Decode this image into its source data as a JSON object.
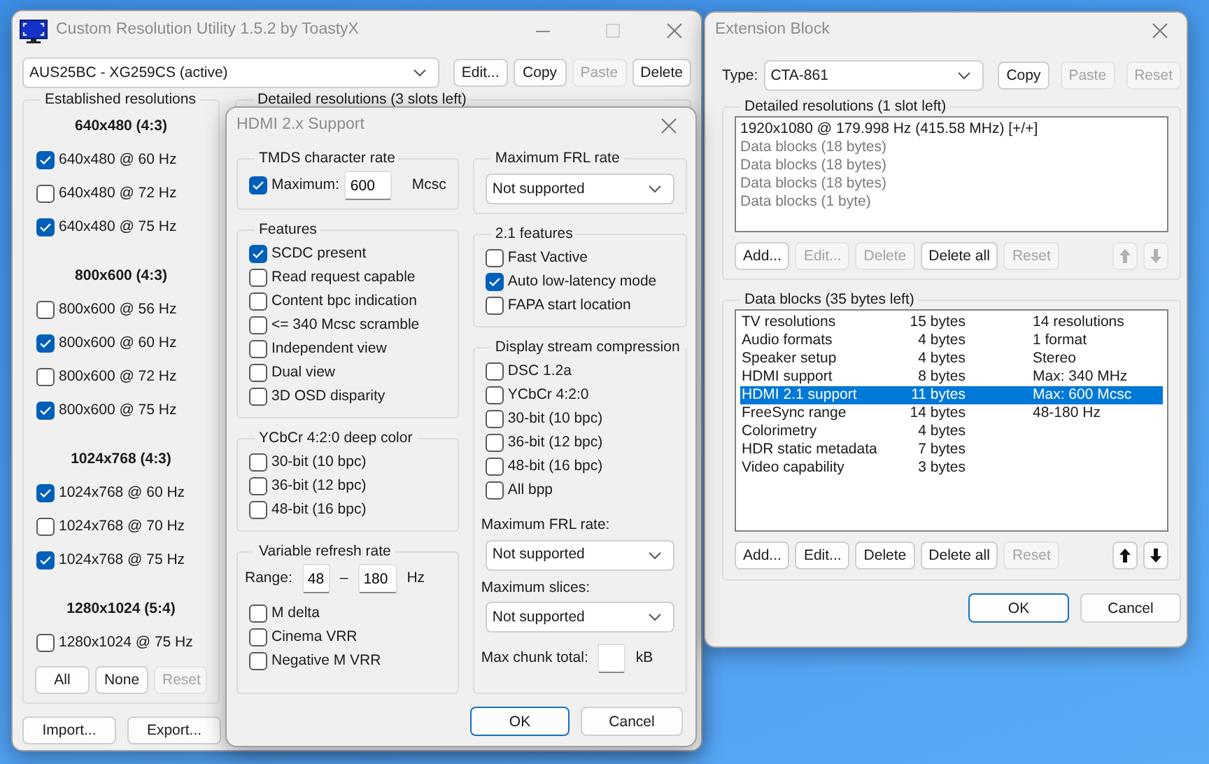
{
  "main_window": {
    "title": "Custom Resolution Utility 1.5.2 by ToastyX",
    "device": "AUS25BC - XG259CS (active)",
    "toolbar": [
      {
        "label": "Edit...",
        "disabled": false
      },
      {
        "label": "Copy",
        "disabled": false
      },
      {
        "label": "Paste",
        "disabled": true
      },
      {
        "label": "Delete",
        "disabled": false
      }
    ],
    "established": {
      "title": "Established resolutions",
      "groups": [
        {
          "heading": "640x480 (4:3)",
          "items": [
            {
              "label": "640x480 @ 60 Hz",
              "checked": true
            },
            {
              "label": "640x480 @ 72 Hz",
              "checked": false
            },
            {
              "label": "640x480 @ 75 Hz",
              "checked": true
            }
          ]
        },
        {
          "heading": "800x600 (4:3)",
          "items": [
            {
              "label": "800x600 @ 56 Hz",
              "checked": false
            },
            {
              "label": "800x600 @ 60 Hz",
              "checked": true
            },
            {
              "label": "800x600 @ 72 Hz",
              "checked": false
            },
            {
              "label": "800x600 @ 75 Hz",
              "checked": true
            }
          ]
        },
        {
          "heading": "1024x768 (4:3)",
          "items": [
            {
              "label": "1024x768 @ 60 Hz",
              "checked": true
            },
            {
              "label": "1024x768 @ 70 Hz",
              "checked": false
            },
            {
              "label": "1024x768 @ 75 Hz",
              "checked": true
            }
          ]
        },
        {
          "heading": "1280x1024 (5:4)",
          "items": [
            {
              "label": "1280x1024 @ 75 Hz",
              "checked": false
            }
          ]
        }
      ],
      "buttons": [
        {
          "label": "All",
          "disabled": false
        },
        {
          "label": "None",
          "disabled": false
        },
        {
          "label": "Reset",
          "disabled": true
        }
      ]
    },
    "detailed_title": "Detailed resolutions (3 slots left)",
    "footer_buttons": [
      {
        "label": "Import..."
      },
      {
        "label": "Export..."
      }
    ]
  },
  "hdmi_dialog": {
    "title": "HDMI 2.x Support",
    "left": [
      {
        "kind": "tmds",
        "title": "TMDS character rate",
        "checkbox": {
          "label": "Maximum:",
          "checked": true
        },
        "value": "600",
        "unit": "Mcsc"
      },
      {
        "kind": "checks",
        "title": "Features",
        "items": [
          {
            "label": "SCDC present",
            "checked": true
          },
          {
            "label": "Read request capable",
            "checked": false
          },
          {
            "label": "Content bpc indication",
            "checked": false
          },
          {
            "label": "<= 340 Mcsc scramble",
            "checked": false
          },
          {
            "label": "Independent view",
            "checked": false
          },
          {
            "label": "Dual view",
            "checked": false
          },
          {
            "label": "3D OSD disparity",
            "checked": false
          }
        ]
      },
      {
        "kind": "checks",
        "title": "YCbCr 4:2:0 deep color",
        "items": [
          {
            "label": "30-bit (10 bpc)",
            "checked": false
          },
          {
            "label": "36-bit (12 bpc)",
            "checked": false
          },
          {
            "label": "48-bit (16 bpc)",
            "checked": false
          }
        ]
      },
      {
        "kind": "vrr",
        "title": "Variable refresh rate",
        "label": "Range:",
        "min": "48",
        "separator": "–",
        "max": "180",
        "unit": "Hz",
        "items": [
          {
            "label": "M delta",
            "checked": false
          },
          {
            "label": "Cinema VRR",
            "checked": false
          },
          {
            "label": "Negative M VRR",
            "checked": false
          }
        ]
      }
    ],
    "right": [
      {
        "kind": "select",
        "title": "Maximum FRL rate",
        "value": "Not supported"
      },
      {
        "kind": "checks",
        "title": "2.1 features",
        "items": [
          {
            "label": "Fast Vactive",
            "checked": false
          },
          {
            "label": "Auto low-latency mode",
            "checked": true
          },
          {
            "label": "FAPA start location",
            "checked": false
          }
        ]
      },
      {
        "kind": "dsc",
        "title": "Display stream compression",
        "items": [
          {
            "label": "DSC 1.2a",
            "checked": false
          },
          {
            "label": "YCbCr 4:2:0",
            "checked": false
          },
          {
            "label": "30-bit (10 bpc)",
            "checked": false
          },
          {
            "label": "36-bit (12 bpc)",
            "checked": false
          },
          {
            "label": "48-bit (16 bpc)",
            "checked": false
          },
          {
            "label": "All bpp",
            "checked": false
          }
        ],
        "fields": [
          {
            "kind": "select",
            "label": "Maximum FRL rate:",
            "value": "Not supported"
          },
          {
            "kind": "select",
            "label": "Maximum slices:",
            "value": "Not supported"
          },
          {
            "kind": "input",
            "label": "Max chunk total:",
            "unit": "kB"
          }
        ]
      }
    ],
    "buttons": [
      {
        "label": "OK",
        "default": true
      },
      {
        "label": "Cancel",
        "default": false
      }
    ]
  },
  "extension_block": {
    "title": "Extension Block",
    "type_label": "Type:",
    "type_value": "CTA-861",
    "buttons": [
      {
        "label": "Copy",
        "disabled": false
      },
      {
        "label": "Paste",
        "disabled": true
      },
      {
        "label": "Reset",
        "disabled": true
      }
    ],
    "detailed": {
      "title": "Detailed resolutions (1 slot left)",
      "items": [
        {
          "text": "1920x1080 @ 179.998 Hz (415.58 MHz) [+/+]",
          "dimmed": false
        },
        {
          "text": "Data blocks (18 bytes)",
          "dimmed": true
        },
        {
          "text": "Data blocks (18 bytes)",
          "dimmed": true
        },
        {
          "text": "Data blocks (18 bytes)",
          "dimmed": true
        },
        {
          "text": "Data blocks (1 byte)",
          "dimmed": true
        }
      ],
      "buttons": [
        {
          "label": "Add...",
          "disabled": false
        },
        {
          "label": "Edit...",
          "disabled": true
        },
        {
          "label": "Delete",
          "disabled": true
        },
        {
          "label": "Delete all",
          "disabled": false
        },
        {
          "label": "Reset",
          "disabled": true
        }
      ],
      "arrows": [
        {
          "kind": "up",
          "disabled": true
        },
        {
          "kind": "down",
          "disabled": true
        }
      ]
    },
    "data_blocks": {
      "title": "Data blocks (35 bytes left)",
      "rows": [
        {
          "name": "TV resolutions",
          "size": "15 bytes",
          "info": "14 resolutions",
          "selected": false
        },
        {
          "name": "Audio formats",
          "size": "4 bytes",
          "info": "1 format",
          "selected": false
        },
        {
          "name": "Speaker setup",
          "size": "4 bytes",
          "info": "Stereo",
          "selected": false
        },
        {
          "name": "HDMI support",
          "size": "8 bytes",
          "info": "Max: 340 MHz",
          "selected": false
        },
        {
          "name": "HDMI 2.1 support",
          "size": "11 bytes",
          "info": "Max: 600 Mcsc",
          "selected": true
        },
        {
          "name": "FreeSync range",
          "size": "14 bytes",
          "info": "48-180 Hz",
          "selected": false
        },
        {
          "name": "Colorimetry",
          "size": "4 bytes",
          "selected": false
        },
        {
          "name": "HDR static metadata",
          "size": "7 bytes",
          "selected": false
        },
        {
          "name": "Video capability",
          "size": "3 bytes",
          "selected": false
        }
      ],
      "buttons": [
        {
          "label": "Add...",
          "disabled": false
        },
        {
          "label": "Edit...",
          "disabled": false
        },
        {
          "label": "Delete",
          "disabled": false
        },
        {
          "label": "Delete all",
          "disabled": false
        },
        {
          "label": "Reset",
          "disabled": true
        }
      ],
      "arrows": [
        {
          "kind": "up",
          "disabled": false
        },
        {
          "kind": "down",
          "disabled": false
        }
      ]
    },
    "dialog_buttons": [
      {
        "label": "OK",
        "default": true
      },
      {
        "label": "Cancel",
        "default": false
      }
    ]
  }
}
